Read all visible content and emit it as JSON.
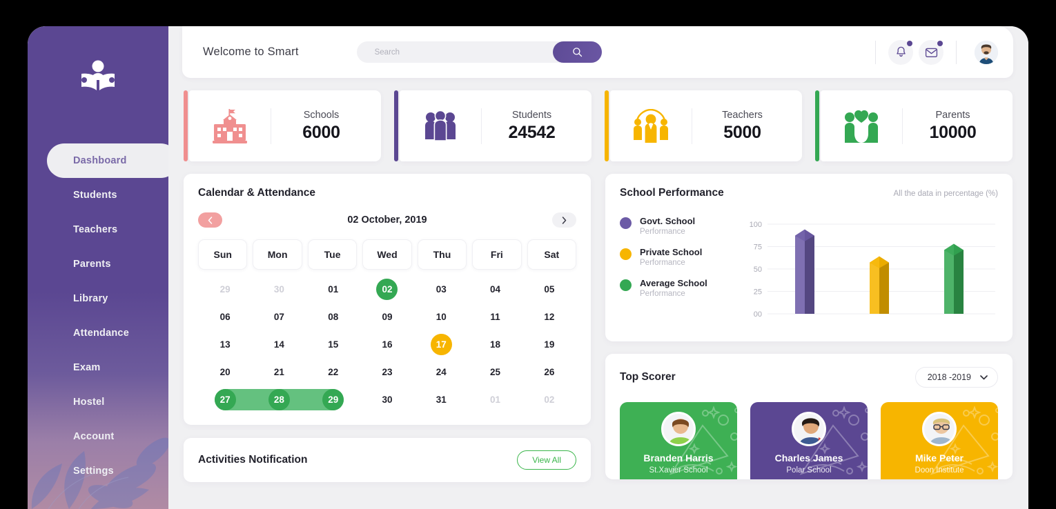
{
  "sidebar": {
    "logo_icon": "book-reader-icon",
    "items": [
      {
        "label": "Dashboard",
        "active": true
      },
      {
        "label": "Students",
        "active": false
      },
      {
        "label": "Teachers",
        "active": false
      },
      {
        "label": "Parents",
        "active": false
      },
      {
        "label": "Library",
        "active": false
      },
      {
        "label": "Attendance",
        "active": false
      },
      {
        "label": "Exam",
        "active": false
      },
      {
        "label": "Hostel",
        "active": false
      },
      {
        "label": "Account",
        "active": false
      },
      {
        "label": "Settings",
        "active": false
      }
    ]
  },
  "header": {
    "welcome": "Welcome to Smart",
    "search_placeholder": "Search",
    "search_value": "",
    "search_icon": "search-icon",
    "notification_icon": "bell-icon",
    "mail_icon": "envelope-icon",
    "avatar_icon": "user-avatar"
  },
  "stats": [
    {
      "label": "Schools",
      "value": "6000",
      "color": "#f08f8f",
      "icon": "school-building-icon"
    },
    {
      "label": "Students",
      "value": "24542",
      "color": "#5b4792",
      "icon": "students-group-icon"
    },
    {
      "label": "Teachers",
      "value": "5000",
      "color": "#f7b500",
      "icon": "teachers-group-icon"
    },
    {
      "label": "Parents",
      "value": "10000",
      "color": "#34a853",
      "icon": "family-heart-icon"
    }
  ],
  "calendar": {
    "title": "Calendar & Attendance",
    "date": "02 October, 2019",
    "prev_icon": "chevron-left-icon",
    "next_icon": "chevron-right-icon",
    "dow": [
      "Sun",
      "Mon",
      "Tue",
      "Wed",
      "Thu",
      "Fri",
      "Sat"
    ],
    "days": [
      {
        "n": "29",
        "state": "muted"
      },
      {
        "n": "30",
        "state": "muted"
      },
      {
        "n": "01",
        "state": "normal"
      },
      {
        "n": "02",
        "state": "sel-green"
      },
      {
        "n": "03",
        "state": "normal"
      },
      {
        "n": "04",
        "state": "normal"
      },
      {
        "n": "05",
        "state": "normal"
      },
      {
        "n": "06",
        "state": "normal"
      },
      {
        "n": "07",
        "state": "normal"
      },
      {
        "n": "08",
        "state": "normal"
      },
      {
        "n": "09",
        "state": "normal"
      },
      {
        "n": "10",
        "state": "normal"
      },
      {
        "n": "11",
        "state": "normal"
      },
      {
        "n": "12",
        "state": "normal"
      },
      {
        "n": "13",
        "state": "normal"
      },
      {
        "n": "14",
        "state": "normal"
      },
      {
        "n": "15",
        "state": "normal"
      },
      {
        "n": "16",
        "state": "normal"
      },
      {
        "n": "17",
        "state": "sel-yellow"
      },
      {
        "n": "18",
        "state": "normal"
      },
      {
        "n": "19",
        "state": "normal"
      },
      {
        "n": "20",
        "state": "normal"
      },
      {
        "n": "21",
        "state": "normal"
      },
      {
        "n": "22",
        "state": "normal"
      },
      {
        "n": "23",
        "state": "normal"
      },
      {
        "n": "24",
        "state": "normal"
      },
      {
        "n": "25",
        "state": "normal"
      },
      {
        "n": "26",
        "state": "normal"
      },
      {
        "n": "27",
        "state": "in-range"
      },
      {
        "n": "28",
        "state": "in-range"
      },
      {
        "n": "29",
        "state": "in-range"
      },
      {
        "n": "30",
        "state": "normal"
      },
      {
        "n": "31",
        "state": "normal"
      },
      {
        "n": "01",
        "state": "muted"
      },
      {
        "n": "02",
        "state": "muted"
      }
    ]
  },
  "activities": {
    "title": "Activities Notification",
    "view_all": "View All"
  },
  "performance": {
    "title": "School Performance",
    "subtitle": "All the data in percentage (%)"
  },
  "chart_data": {
    "type": "bar",
    "title": "School Performance",
    "subtitle": "All the data in percentage (%)",
    "categories": [
      "Govt. School",
      "Private School",
      "Average School"
    ],
    "values": [
      91,
      61,
      75
    ],
    "series": [
      {
        "name": "Govt. School",
        "sublabel": "Performance",
        "value": 91,
        "color": "#6c5ba6"
      },
      {
        "name": "Private School",
        "sublabel": "Performance",
        "value": 61,
        "color": "#f7b500"
      },
      {
        "name": "Average School",
        "sublabel": "Performance",
        "value": 75,
        "color": "#34a853"
      }
    ],
    "ylabel": "",
    "xlabel": "",
    "ylim": [
      0,
      100
    ],
    "yticks": [
      "00",
      "25",
      "50",
      "75",
      "100"
    ],
    "grid": true,
    "legend": "left"
  },
  "scorer": {
    "title": "Top Scorer",
    "year": "2018 -2019",
    "chevron_icon": "chevron-down-icon",
    "items": [
      {
        "name": "Branden Harris",
        "school": "St.Xavier School",
        "color": "#3eb054"
      },
      {
        "name": "Charles James",
        "school": "Polar School",
        "color": "#5b4792"
      },
      {
        "name": "Mike Peter",
        "school": "Doon Institute",
        "color": "#f7b500"
      }
    ]
  }
}
